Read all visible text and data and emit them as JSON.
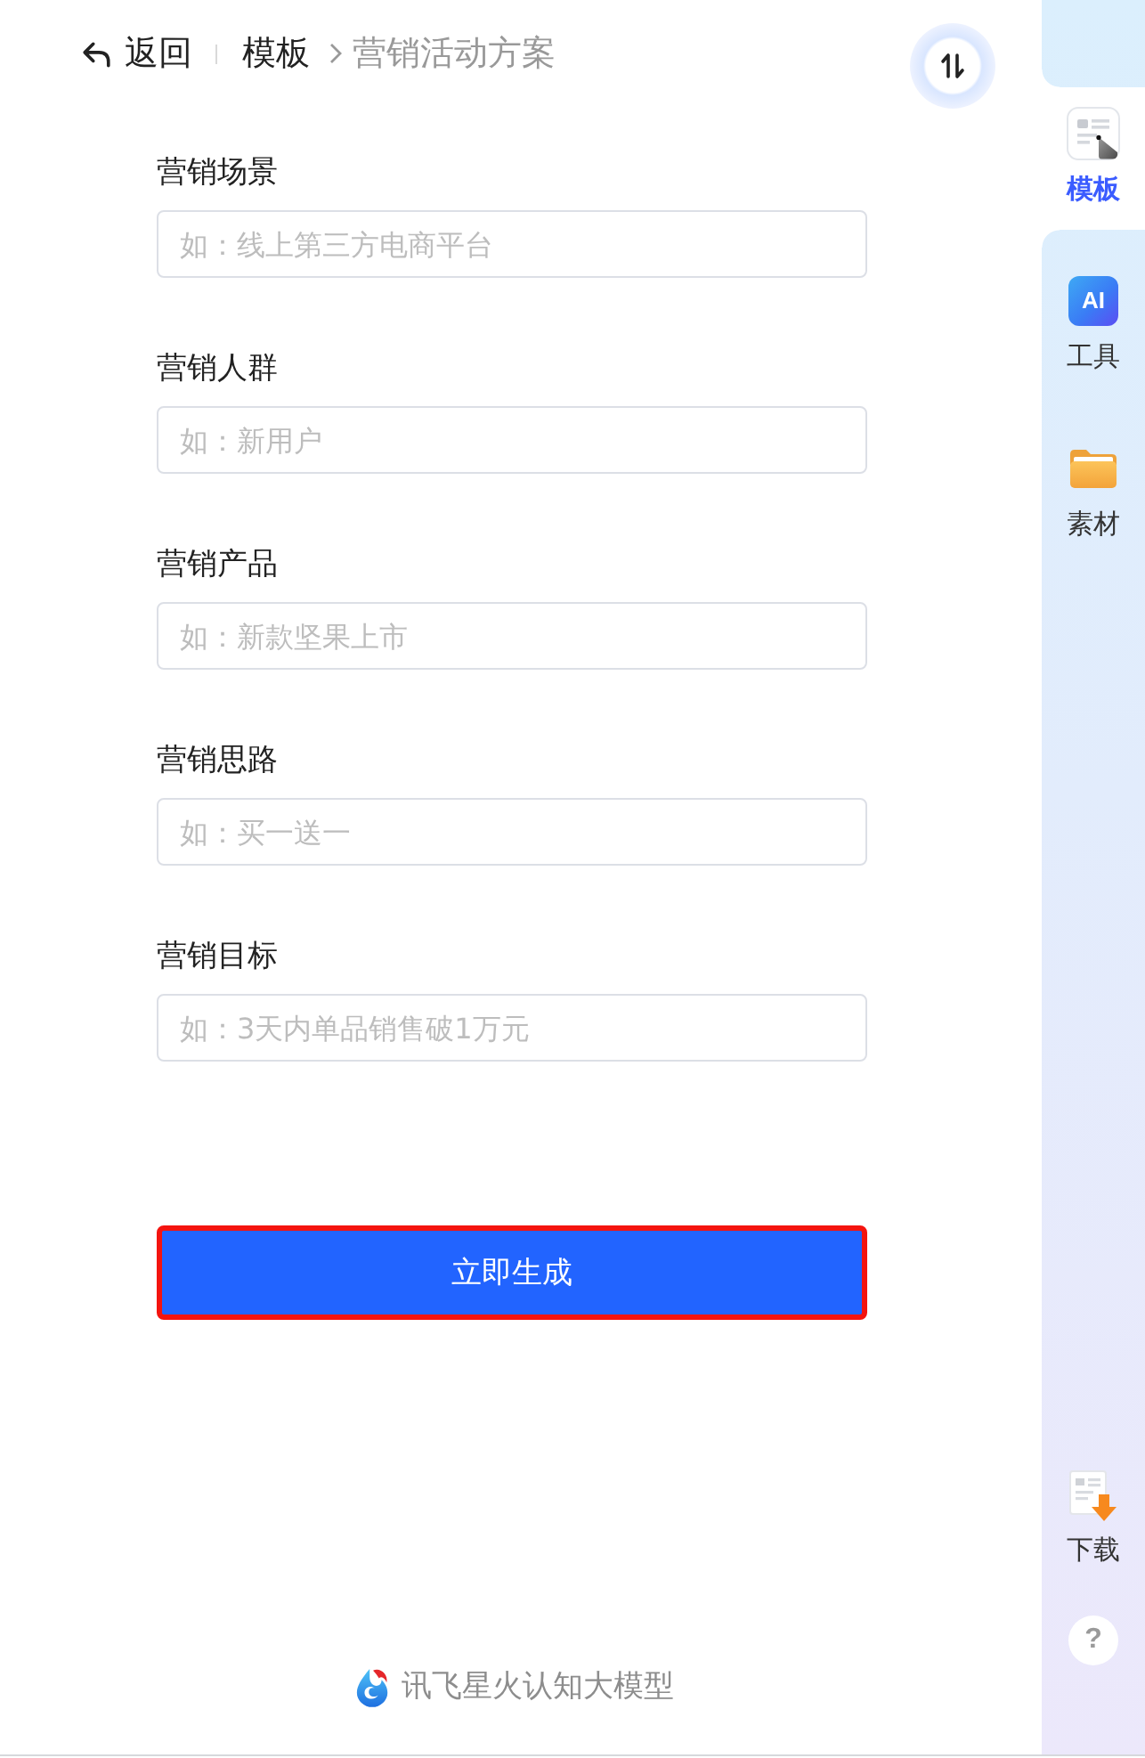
{
  "header": {
    "back": "返回",
    "breadcrumb": [
      {
        "label": "模板",
        "current": false
      },
      {
        "label": "营销活动方案",
        "current": true
      }
    ]
  },
  "form": {
    "fields": [
      {
        "label": "营销场景",
        "placeholder": "如：线上第三方电商平台"
      },
      {
        "label": "营销人群",
        "placeholder": "如：新用户"
      },
      {
        "label": "营销产品",
        "placeholder": "如：新款坚果上市"
      },
      {
        "label": "营销思路",
        "placeholder": "如：买一送一"
      },
      {
        "label": "营销目标",
        "placeholder": "如：3天内单品销售破1万元"
      }
    ],
    "submit": "立即生成"
  },
  "footer": {
    "brand": "讯飞星火认知大模型"
  },
  "sidebar": {
    "items": [
      {
        "kind": "template",
        "label": "模板",
        "selected": true
      },
      {
        "kind": "ai",
        "icon_text": "AI",
        "label": "工具",
        "selected": false
      },
      {
        "kind": "folder",
        "label": "素材",
        "selected": false
      }
    ],
    "bottom": [
      {
        "kind": "download",
        "label": "下载"
      },
      {
        "kind": "help",
        "label": "?"
      }
    ]
  }
}
